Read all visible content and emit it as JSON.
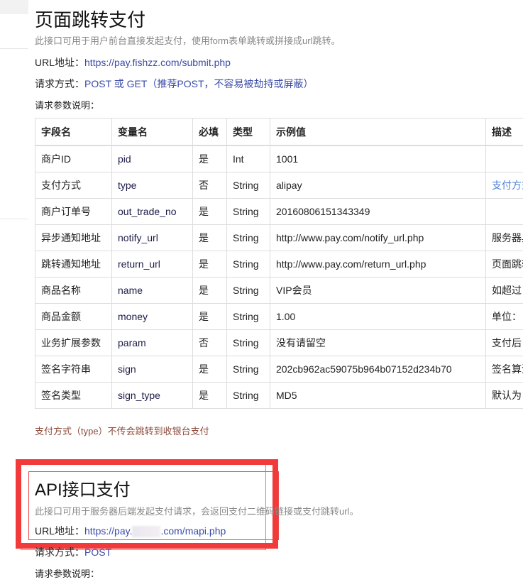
{
  "section1": {
    "title": "页面跳转支付",
    "description": "此接口可用于用户前台直接发起支付，使用form表单跳转或拼接成url跳转。",
    "url_label": "URL地址：",
    "url": "https://pay.fishzz.com/submit.php",
    "method_label": "请求方式：",
    "method": "POST 或 GET（推荐POST，不容易被劫持或屏蔽）",
    "params_label": "请求参数说明：",
    "table": {
      "headers": [
        "字段名",
        "变量名",
        "必填",
        "类型",
        "示例值",
        "描述"
      ],
      "rows": [
        [
          "商户ID",
          "pid",
          "是",
          "Int",
          "1001",
          ""
        ],
        [
          "支付方式",
          "type",
          "否",
          "String",
          "alipay",
          "支付方式"
        ],
        [
          "商户订单号",
          "out_trade_no",
          "是",
          "String",
          "20160806151343349",
          ""
        ],
        [
          "异步通知地址",
          "notify_url",
          "是",
          "String",
          "http://www.pay.com/notify_url.php",
          "服务器异"
        ],
        [
          "跳转通知地址",
          "return_url",
          "是",
          "String",
          "http://www.pay.com/return_url.php",
          "页面跳转"
        ],
        [
          "商品名称",
          "name",
          "是",
          "String",
          "VIP会员",
          "如超过"
        ],
        [
          "商品金额",
          "money",
          "是",
          "String",
          "1.00",
          "单位："
        ],
        [
          "业务扩展参数",
          "param",
          "否",
          "String",
          "没有请留空",
          "支付后"
        ],
        [
          "签名字符串",
          "sign",
          "是",
          "String",
          "202cb962ac59075b964b07152d234b70",
          "签名算法"
        ],
        [
          "签名类型",
          "sign_type",
          "是",
          "String",
          "MD5",
          "默认为"
        ]
      ]
    },
    "note": "支付方式（type）不传会跳转到收银台支付"
  },
  "section2": {
    "title": "API接口支付",
    "description": "此接口可用于服务器后端发起支付请求，会返回支付二维码链接或支付跳转url。",
    "url_label": "URL地址：",
    "url_prefix": "https://pay.",
    "url_suffix": ".com/mapi.php",
    "method_label": "请求方式：",
    "method": "POST",
    "params_label": "请求参数说明："
  },
  "colors": {
    "link": "#3a4ca8",
    "highlight_box": "#f33a3a",
    "note": "#8b4a3a"
  }
}
